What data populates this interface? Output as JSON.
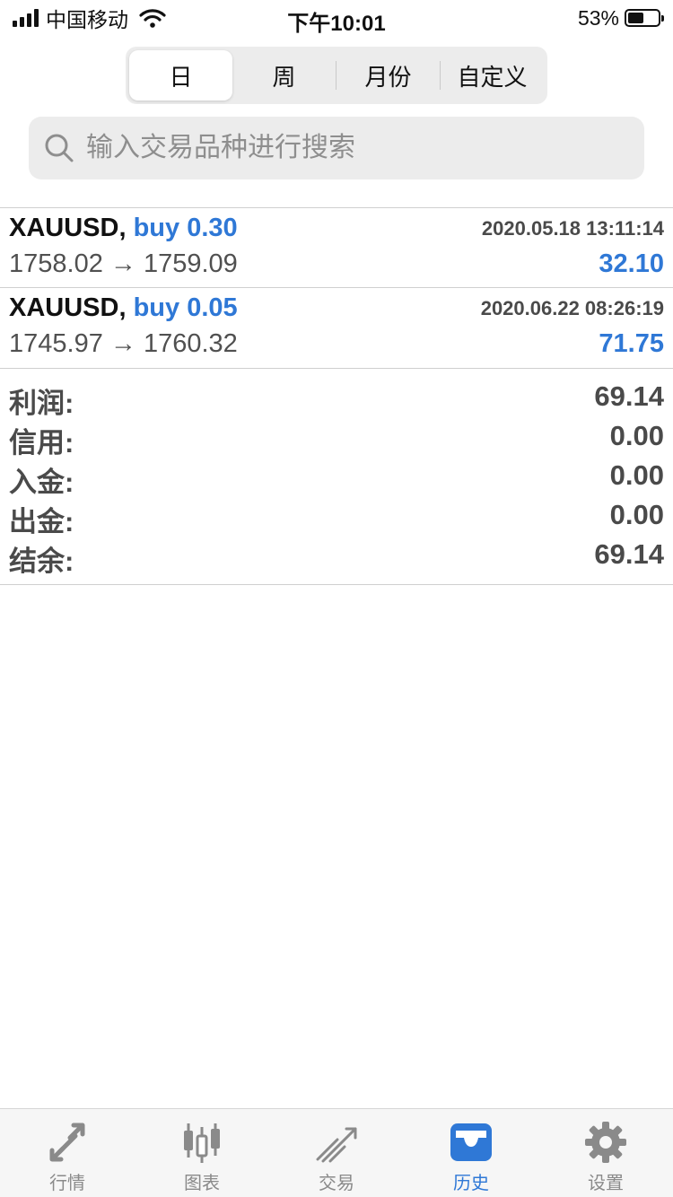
{
  "status_bar": {
    "carrier": "中国移动",
    "time": "下午10:01",
    "battery_percent": "53%",
    "battery_level": 0.53
  },
  "segments": [
    {
      "label": "日",
      "active": true
    },
    {
      "label": "周",
      "active": false
    },
    {
      "label": "月份",
      "active": false
    },
    {
      "label": "自定义",
      "active": false
    }
  ],
  "search": {
    "placeholder": "输入交易品种进行搜索",
    "value": ""
  },
  "deals": [
    {
      "symbol": "XAUUSD,",
      "side_volume": "buy 0.30",
      "time": "2020.05.18 13:11:14",
      "prices": "1758.02 → 1759.09",
      "profit": "32.10"
    },
    {
      "symbol": "XAUUSD,",
      "side_volume": "buy 0.05",
      "time": "2020.06.22 08:26:19",
      "prices": "1745.97 → 1760.32",
      "profit": "71.75"
    }
  ],
  "summary": [
    {
      "label": "利润:",
      "value": "69.14"
    },
    {
      "label": "信用:",
      "value": "0.00"
    },
    {
      "label": "入金:",
      "value": "0.00"
    },
    {
      "label": "出金:",
      "value": "0.00"
    },
    {
      "label": "结余:",
      "value": "69.14"
    }
  ],
  "tabs": [
    {
      "label": "行情",
      "icon": "quotes-arrows-icon",
      "active": false
    },
    {
      "label": "图表",
      "icon": "candlestick-chart-icon",
      "active": false
    },
    {
      "label": "交易",
      "icon": "trade-lines-icon",
      "active": false
    },
    {
      "label": "历史",
      "icon": "history-inbox-icon",
      "active": true
    },
    {
      "label": "设置",
      "icon": "gear-icon",
      "active": false
    }
  ],
  "colors": {
    "accent": "#2f78d6",
    "tab_inactive": "#8a8a8a",
    "text_secondary": "#4a4a4a"
  }
}
